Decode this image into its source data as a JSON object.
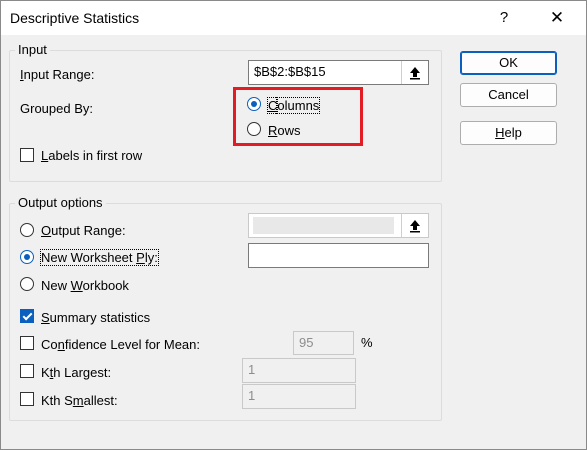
{
  "window": {
    "title": "Descriptive Statistics",
    "help_label": "?",
    "close_label": "✕"
  },
  "input_group": {
    "legend": "Input",
    "input_range_label": "Input Range:",
    "input_range_value": "$B$2:$B$15",
    "grouped_by_label": "Grouped By:",
    "grouped_by_options": [
      {
        "label": "Columns",
        "selected": true
      },
      {
        "label": "Rows",
        "selected": false
      }
    ],
    "labels_first_row": {
      "label": "Labels in first row",
      "checked": false
    }
  },
  "output_group": {
    "legend": "Output options",
    "output_range": {
      "label": "Output Range:",
      "selected": false,
      "value": ""
    },
    "new_worksheet": {
      "label": "New Worksheet Ply:",
      "selected": true,
      "value": ""
    },
    "new_workbook": {
      "label": "New Workbook",
      "selected": false
    },
    "summary_statistics": {
      "label": "Summary statistics",
      "checked": true
    },
    "confidence_level": {
      "label": "Confidence Level for Mean:",
      "checked": false,
      "value": "95",
      "unit": "%"
    },
    "kth_largest": {
      "label": "Kth Largest:",
      "checked": false,
      "value": "1"
    },
    "kth_smallest": {
      "label": "Kth Smallest:",
      "checked": false,
      "value": "1"
    }
  },
  "buttons": {
    "ok": "OK",
    "cancel": "Cancel",
    "help": "Help"
  },
  "colors": {
    "accent": "#0a5fbf",
    "highlight": "#e31b23"
  }
}
